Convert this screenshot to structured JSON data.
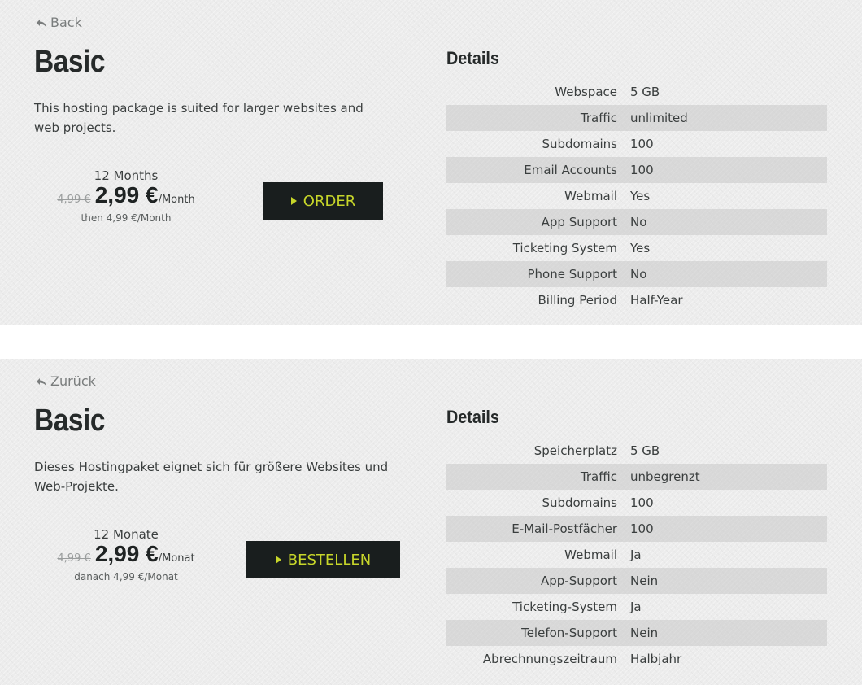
{
  "panels": [
    {
      "back": "Back",
      "title": "Basic",
      "description": "This hosting package is suited for larger websites and web projects.",
      "price": {
        "period": "12 Months",
        "old": "4,99 €",
        "new": "2,99 €",
        "unit": "/Month",
        "then": "then 4,99 €/Month"
      },
      "order_button": "ORDER",
      "details_heading": "Details",
      "details": [
        {
          "label": "Webspace",
          "value": "5 GB"
        },
        {
          "label": "Traffic",
          "value": "unlimited"
        },
        {
          "label": "Subdomains",
          "value": "100"
        },
        {
          "label": "Email Accounts",
          "value": "100"
        },
        {
          "label": "Webmail",
          "value": "Yes"
        },
        {
          "label": "App Support",
          "value": "No"
        },
        {
          "label": "Ticketing System",
          "value": "Yes"
        },
        {
          "label": "Phone Support",
          "value": "No"
        },
        {
          "label": "Billing Period",
          "value": "Half-Year"
        }
      ]
    },
    {
      "back": "Zurück",
      "title": "Basic",
      "description": "Dieses Hostingpaket eignet sich für größere Websites und Web-Projekte.",
      "price": {
        "period": "12 Monate",
        "old": "4,99 €",
        "new": "2,99 €",
        "unit": "/Monat",
        "then": "danach 4,99 €/Monat"
      },
      "order_button": "BESTELLEN",
      "details_heading": "Details",
      "details": [
        {
          "label": "Speicherplatz",
          "value": "5 GB"
        },
        {
          "label": "Traffic",
          "value": "unbegrenzt"
        },
        {
          "label": "Subdomains",
          "value": "100"
        },
        {
          "label": "E-Mail-Postfächer",
          "value": "100"
        },
        {
          "label": "Webmail",
          "value": "Ja"
        },
        {
          "label": "App-Support",
          "value": "Nein"
        },
        {
          "label": "Ticketing-System",
          "value": "Ja"
        },
        {
          "label": "Telefon-Support",
          "value": "Nein"
        },
        {
          "label": "Abrechnungszeitraum",
          "value": "Halbjahr"
        }
      ]
    }
  ],
  "colors": {
    "panel_background": "#ececec",
    "button_background": "#191e1e",
    "button_text": "#c7d62a",
    "stripe": "#d8d8d8"
  }
}
